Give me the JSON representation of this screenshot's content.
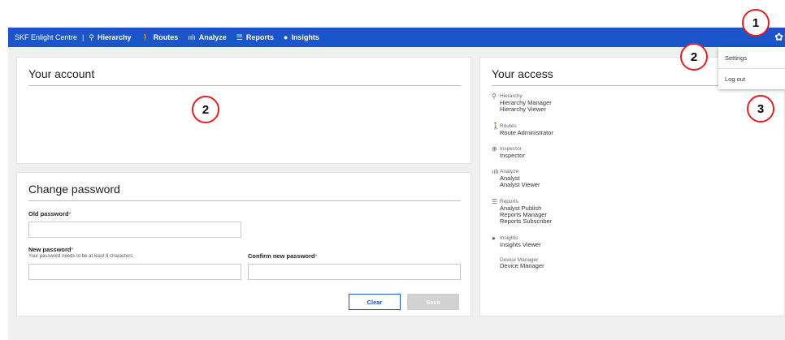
{
  "nav": {
    "brand": "SKF Enlight Centre",
    "separator": "|",
    "items": [
      {
        "label": "Hierarchy",
        "icon": "hierarchy-icon",
        "glyph": "⚲"
      },
      {
        "label": "Routes",
        "icon": "routes-icon",
        "glyph": "🚶"
      },
      {
        "label": "Analyze",
        "icon": "analyze-icon",
        "glyph": "ıılı"
      },
      {
        "label": "Reports",
        "icon": "reports-icon",
        "glyph": "☰"
      },
      {
        "label": "Insights",
        "icon": "insights-icon",
        "glyph": "●"
      }
    ],
    "gear_glyph": "✿"
  },
  "account": {
    "title": "Your account"
  },
  "password": {
    "title": "Change password",
    "old_label": "Old password",
    "new_label": "New password",
    "confirm_label": "Confirm new password",
    "required_mark": "*",
    "hint": "Your password needs to be at least 8 characters.",
    "old_value": "",
    "new_value": "",
    "confirm_value": "",
    "clear_label": "Clear",
    "save_label": "Save"
  },
  "access": {
    "title": "Your access",
    "groups": [
      {
        "name": "Hierarchy",
        "glyph": "⚲",
        "roles": [
          "Hierarchy Manager",
          "Hierarchy Viewer"
        ]
      },
      {
        "name": "Routes",
        "glyph": "🚶",
        "roles": [
          "Route Administrator"
        ]
      },
      {
        "name": "Inspector",
        "glyph": "⊕",
        "roles": [
          "Inspector"
        ]
      },
      {
        "name": "Analyze",
        "glyph": "ıılı",
        "roles": [
          "Analyst",
          "Analyst Viewer"
        ]
      },
      {
        "name": "Reports",
        "glyph": "☰",
        "roles": [
          "Analyst Publish",
          "Reports Manager",
          "Reports Subscriber"
        ]
      },
      {
        "name": "Insights",
        "glyph": "●",
        "roles": [
          "Insights Viewer"
        ]
      },
      {
        "name": "Device Manager",
        "glyph": "",
        "roles": [
          "Device Manager"
        ]
      }
    ]
  },
  "menu": {
    "settings": "Settings",
    "logout": "Log out"
  },
  "callouts": [
    "1",
    "2",
    "2",
    "3"
  ],
  "colors": {
    "nav": "#1a56c9",
    "callout_border": "#e02020",
    "required": "#d93030"
  }
}
